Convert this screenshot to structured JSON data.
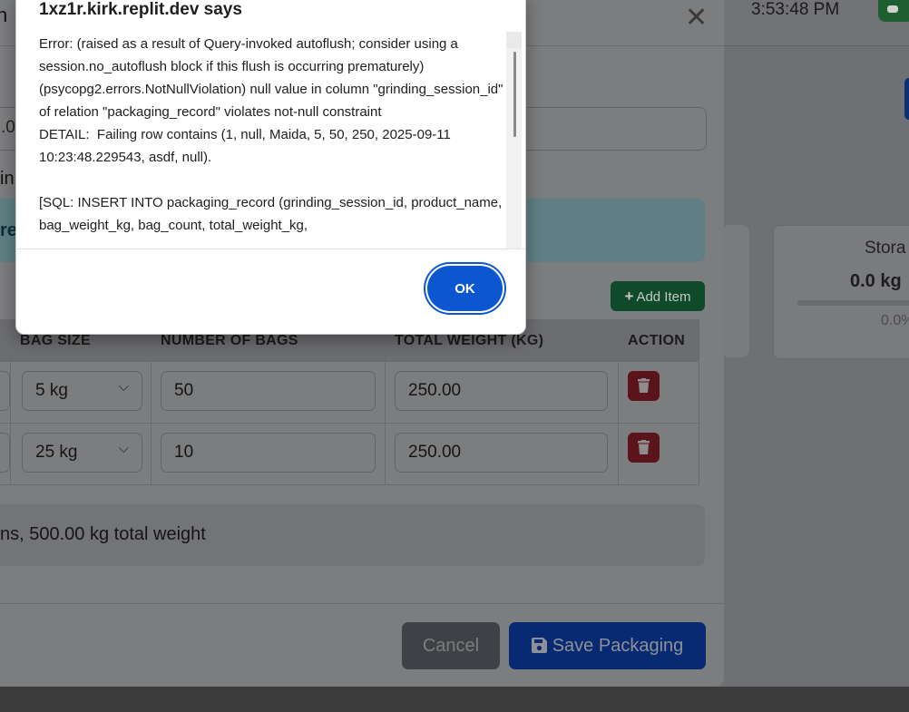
{
  "background": {
    "clock": "3:53:48 PM",
    "storage_card": {
      "label": "Stora",
      "value": "0.0 kg",
      "percent": "0.0%"
    }
  },
  "modal": {
    "title_fragment": "n",
    "input_fragment": ".0",
    "text_fragment": "in",
    "alert_fragment": "re",
    "add_item_label": "Add Item",
    "table": {
      "headers": [
        "BAG SIZE",
        "NUMBER OF BAGS",
        "TOTAL WEIGHT (KG)",
        "ACTION"
      ],
      "rows": [
        {
          "bag_size": "5 kg",
          "number_of_bags": "50",
          "total_weight": "250.00"
        },
        {
          "bag_size": "25 kg",
          "number_of_bags": "10",
          "total_weight": "250.00"
        }
      ]
    },
    "summary": "ns, 500.00 kg total weight",
    "cancel_label": "Cancel",
    "save_label": "Save Packaging"
  },
  "dialog": {
    "title": "1xz1r.kirk.replit.dev says",
    "message": "Error: (raised as a result of Query-invoked autoflush; consider using a session.no_autoflush block if this flush is occurring prematurely)\n(psycopg2.errors.NotNullViolation) null value in column \"grinding_session_id\" of relation \"packaging_record\" violates not-null constraint\nDETAIL:  Failing row contains (1, null, Maida, 5, 50, 250, 2025-09-11 10:23:48.229543, asdf, null).\n\n[SQL: INSERT INTO packaging_record (grinding_session_id, product_name, bag_weight_kg, bag_count, total_weight_kg,",
    "ok_label": "OK"
  }
}
